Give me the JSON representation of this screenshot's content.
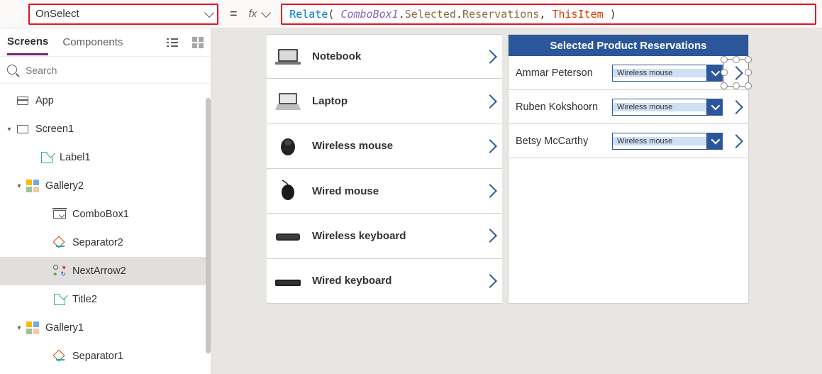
{
  "topbar": {
    "property": "OnSelect",
    "equals": "=",
    "fx": "fx",
    "formula": {
      "fn": "Relate",
      "open": "( ",
      "id": "ComboBox1",
      "dot1": ".",
      "p1": "Selected",
      "dot2": ".",
      "p2": "Reservations",
      "comma": ", ",
      "kw": "ThisItem",
      "close": " )"
    }
  },
  "left": {
    "tabs": {
      "screens": "Screens",
      "components": "Components"
    },
    "search_placeholder": "Search",
    "nodes": {
      "app": "App",
      "screen1": "Screen1",
      "label1": "Label1",
      "gallery2": "Gallery2",
      "combobox1": "ComboBox1",
      "separator2": "Separator2",
      "nextarrow2": "NextArrow2",
      "title2": "Title2",
      "gallery1": "Gallery1",
      "separator1": "Separator1"
    }
  },
  "canvas": {
    "products": [
      {
        "name": "Notebook"
      },
      {
        "name": "Laptop"
      },
      {
        "name": "Wireless mouse"
      },
      {
        "name": "Wired mouse"
      },
      {
        "name": "Wireless keyboard"
      },
      {
        "name": "Wired keyboard"
      }
    ],
    "right_header": "Selected Product Reservations",
    "combo_value": "Wireless mouse",
    "reservations": [
      {
        "person": "Ammar Peterson"
      },
      {
        "person": "Ruben Kokshoorn"
      },
      {
        "person": "Betsy McCarthy"
      }
    ]
  }
}
